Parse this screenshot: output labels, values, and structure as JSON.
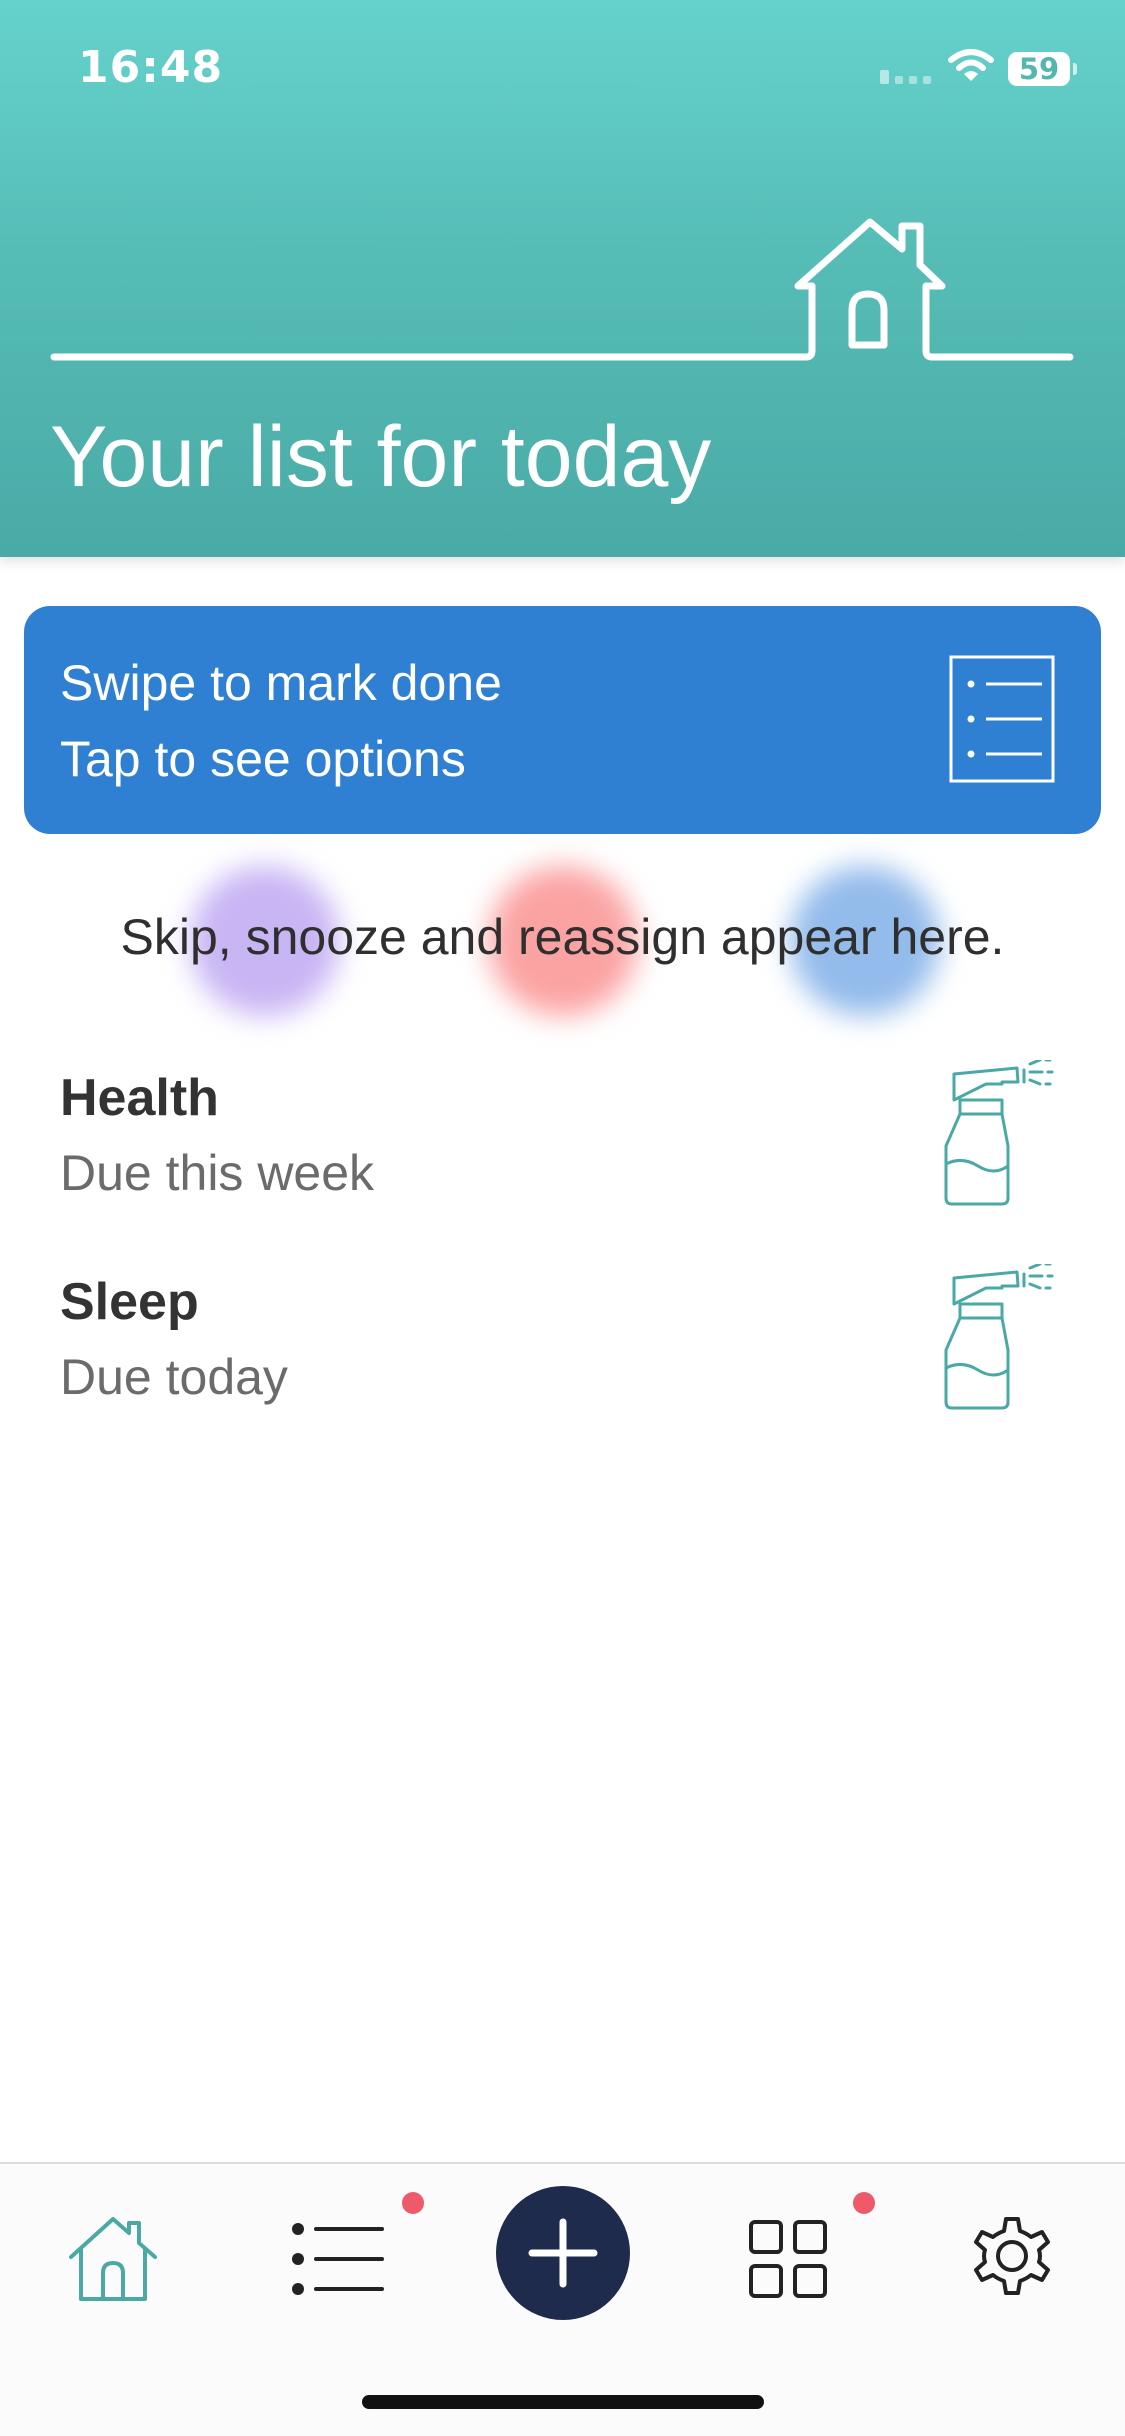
{
  "status_bar": {
    "time": "16:48",
    "battery": "59",
    "icons": [
      "signal-icon",
      "wifi-icon",
      "battery-icon"
    ]
  },
  "header": {
    "title": "Your list for today",
    "illustration": "house-line-icon",
    "colors": {
      "gradient_top": "#66d2cc",
      "gradient_bottom": "#4aaaa6"
    }
  },
  "tip_card": {
    "line1": "Swipe to mark done",
    "line2": "Tap to see options",
    "icon": "list-document-icon",
    "color": "#2f80d2"
  },
  "hint": {
    "text": "Skip, snooze and reassign appear here.",
    "colors": [
      "#b59cf0",
      "#fa8c8c",
      "#78aae6"
    ]
  },
  "tasks": [
    {
      "title": "Health",
      "due": "Due this week",
      "icon": "spray-bottle-icon"
    },
    {
      "title": "Sleep",
      "due": "Due today",
      "icon": "spray-bottle-icon"
    }
  ],
  "bottom_nav": {
    "items": [
      {
        "name": "home",
        "icon": "home-icon",
        "active": true
      },
      {
        "name": "list",
        "icon": "list-icon",
        "badge": true
      },
      {
        "name": "add",
        "icon": "plus-icon"
      },
      {
        "name": "grid",
        "icon": "grid-icon",
        "badge": true
      },
      {
        "name": "settings",
        "icon": "gear-icon"
      }
    ],
    "accent": "#4aa9a5",
    "badge_color": "#ee5a6a",
    "add_button_color": "#1f2b4d"
  }
}
